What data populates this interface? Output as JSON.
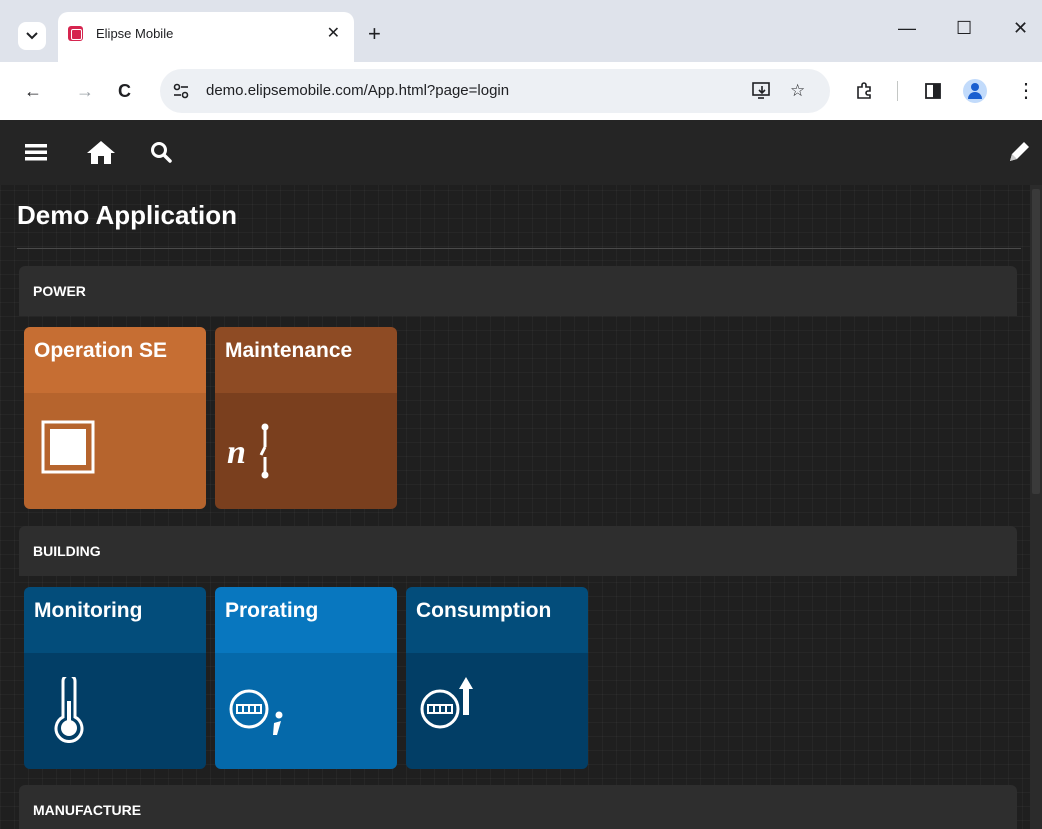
{
  "browser": {
    "tab_title": "Elipse Mobile",
    "url": "demo.elipsemobile.com/App.html?page=login",
    "new_tab_symbol": "+",
    "close_symbol": "✕",
    "min_symbol": "—",
    "max_symbol": "☐",
    "win_close_symbol": "✕",
    "back_symbol": "←",
    "forward_symbol": "→",
    "reload_symbol": "C",
    "star_symbol": "☆",
    "menu_symbol": "⋮",
    "favicon_color": "#d6254f"
  },
  "app": {
    "title": "Demo Application",
    "appbar_icons": [
      "menu-icon",
      "home-icon",
      "search-icon",
      "edit-pencil-icon"
    ],
    "sections": [
      {
        "label": "POWER",
        "tiles": [
          {
            "label": "Operation SE",
            "icon": "substation-square-icon",
            "head_color": "#c66e33",
            "body_color": "#b6642d"
          },
          {
            "label": "Maintenance",
            "icon": "maintenance-n-switch-icon",
            "head_color": "#8e4b24",
            "body_color": "#7a3f1e"
          }
        ]
      },
      {
        "label": "BUILDING",
        "tiles": [
          {
            "label": "Monitoring",
            "icon": "thermometer-icon",
            "head_color": "#034d7b",
            "body_color": "#023e66"
          },
          {
            "label": "Prorating",
            "icon": "meter-info-icon",
            "head_color": "#0877bf",
            "body_color": "#0569aa"
          },
          {
            "label": "Consumption",
            "icon": "meter-up-arrow-icon",
            "head_color": "#034d7b",
            "body_color": "#023e66"
          }
        ]
      },
      {
        "label": "MANUFACTURE",
        "tiles": []
      }
    ]
  }
}
